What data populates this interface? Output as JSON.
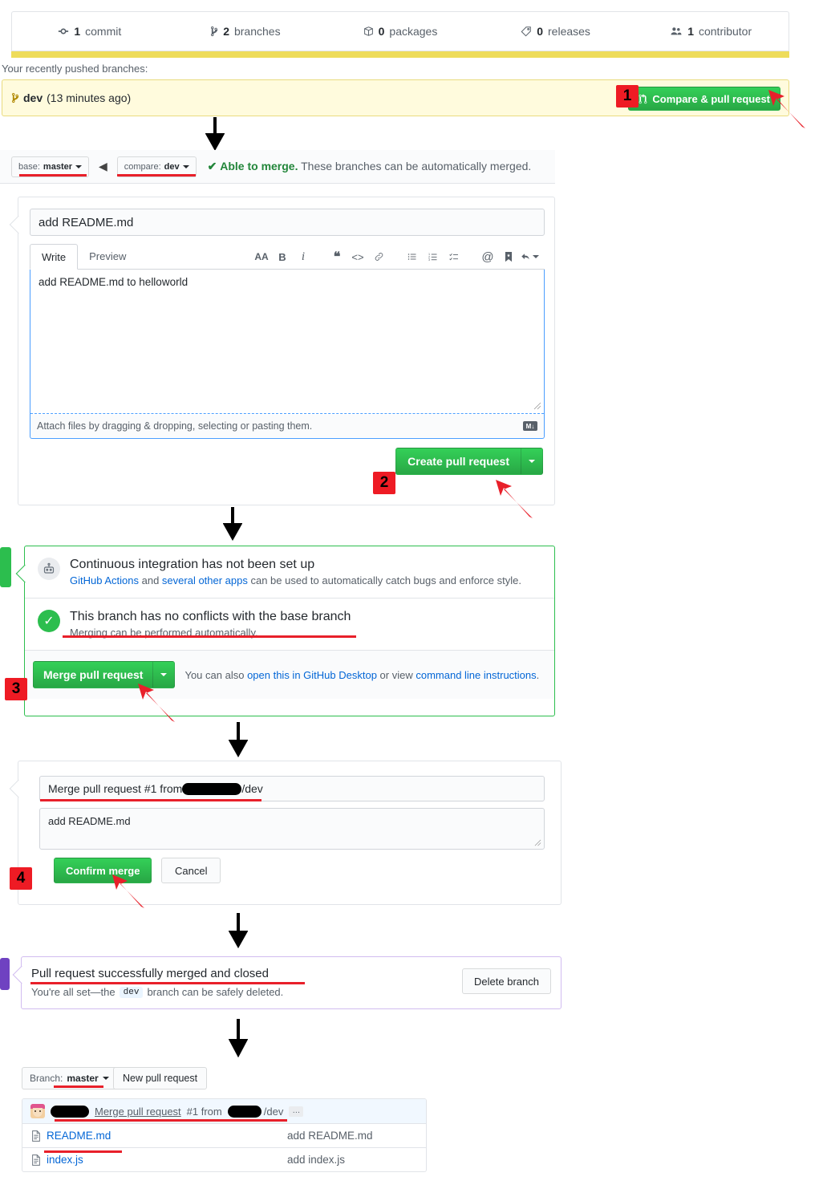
{
  "repo_stats": [
    {
      "icon": "commit-icon",
      "count": "1",
      "label": "commit"
    },
    {
      "icon": "branch-icon",
      "count": "2",
      "label": "branches"
    },
    {
      "icon": "package-icon",
      "count": "0",
      "label": "packages"
    },
    {
      "icon": "tag-icon",
      "count": "0",
      "label": "releases"
    },
    {
      "icon": "people-icon",
      "count": "1",
      "label": "contributor"
    }
  ],
  "pushed": {
    "label": "Your recently pushed branches:",
    "branch": "dev",
    "time": "(13 minutes ago)",
    "compare_button": "Compare & pull request"
  },
  "compare": {
    "base_prefix": "base:",
    "base_value": "master",
    "compare_prefix": "compare:",
    "compare_value": "dev",
    "status_ok": "Able to merge.",
    "status_rest": " These branches can be automatically merged."
  },
  "pr_form": {
    "title_value": "add README.md",
    "tab_write": "Write",
    "tab_preview": "Preview",
    "toolbar": [
      "heading-icon",
      "bold-icon",
      "italic-icon",
      "quote-icon",
      "code-icon",
      "link-icon",
      "unordered-list-icon",
      "ordered-list-icon",
      "task-list-icon",
      "mention-icon",
      "reference-icon",
      "reply-icon"
    ],
    "body_value": "add README.md to helloworld",
    "attach_text": "Attach files by dragging & dropping, selecting or pasting them.",
    "markdown_badge": "M↓",
    "create_button": "Create pull request"
  },
  "merge_box": {
    "ci_title": "Continuous integration has not been set up",
    "ci_sub_link1": "GitHub Actions",
    "ci_sub_mid": " and ",
    "ci_sub_link2": "several other apps",
    "ci_sub_rest": " can be used to automatically catch bugs and enforce style.",
    "conflict_title": "This branch has no conflicts with the base branch",
    "conflict_sub": "Merging can be performed automatically.",
    "merge_button": "Merge pull request",
    "help_prefix": "You can also ",
    "help_link1": "open this in GitHub Desktop",
    "help_mid": " or view ",
    "help_link2": "command line instructions",
    "help_end": "."
  },
  "confirm_merge": {
    "commit_title_prefix": "Merge pull request #1 from ",
    "commit_title_suffix": "/dev",
    "commit_desc": "add README.md",
    "confirm_button": "Confirm merge",
    "cancel_button": "Cancel"
  },
  "merged": {
    "title": "Pull request successfully merged and closed",
    "sub_prefix": "You're all set—the ",
    "sub_branch": "dev",
    "sub_suffix": " branch can be safely deleted.",
    "delete_button": "Delete branch"
  },
  "repo_files": {
    "branch_prefix": "Branch:",
    "branch_value": "master",
    "new_pr_button": "New pull request",
    "commit_link": "Merge pull request",
    "commit_rest": "#1 from",
    "commit_suffix": "/dev",
    "commit_dots": "…",
    "rows": [
      {
        "icon": "file-icon",
        "name": "README.md",
        "message": "add README.md"
      },
      {
        "icon": "file-icon",
        "name": "index.js",
        "message": "add index.js"
      }
    ]
  },
  "annotations": {
    "steps": [
      "1",
      "2",
      "3",
      "4"
    ],
    "badge_color": "#ee1b24",
    "arrow_color": "#e8202a",
    "flow_arrow_color": "#000000"
  }
}
